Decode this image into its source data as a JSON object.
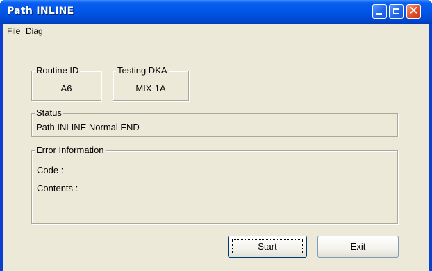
{
  "window": {
    "title": "Path INLINE",
    "controls": {
      "minimize": "minimize-icon",
      "maximize": "maximize-icon",
      "close": "close-icon"
    }
  },
  "menu": {
    "file": {
      "mnemonic": "F",
      "rest": "ile"
    },
    "diag": {
      "mnemonic": "D",
      "rest": "iag"
    }
  },
  "routine_id": {
    "label": "Routine ID",
    "value": "A6"
  },
  "testing_dka": {
    "label": "Testing DKA",
    "value": "MIX-1A"
  },
  "status": {
    "label": "Status",
    "value": "Path INLINE Normal END"
  },
  "error_info": {
    "label": "Error Information",
    "code_label": "Code :",
    "contents_label": "Contents :"
  },
  "buttons": {
    "start": "Start",
    "exit": "Exit"
  },
  "colors": {
    "titlebar": "#0056e6",
    "client": "#ece9d8",
    "close_button": "#e0502a"
  }
}
